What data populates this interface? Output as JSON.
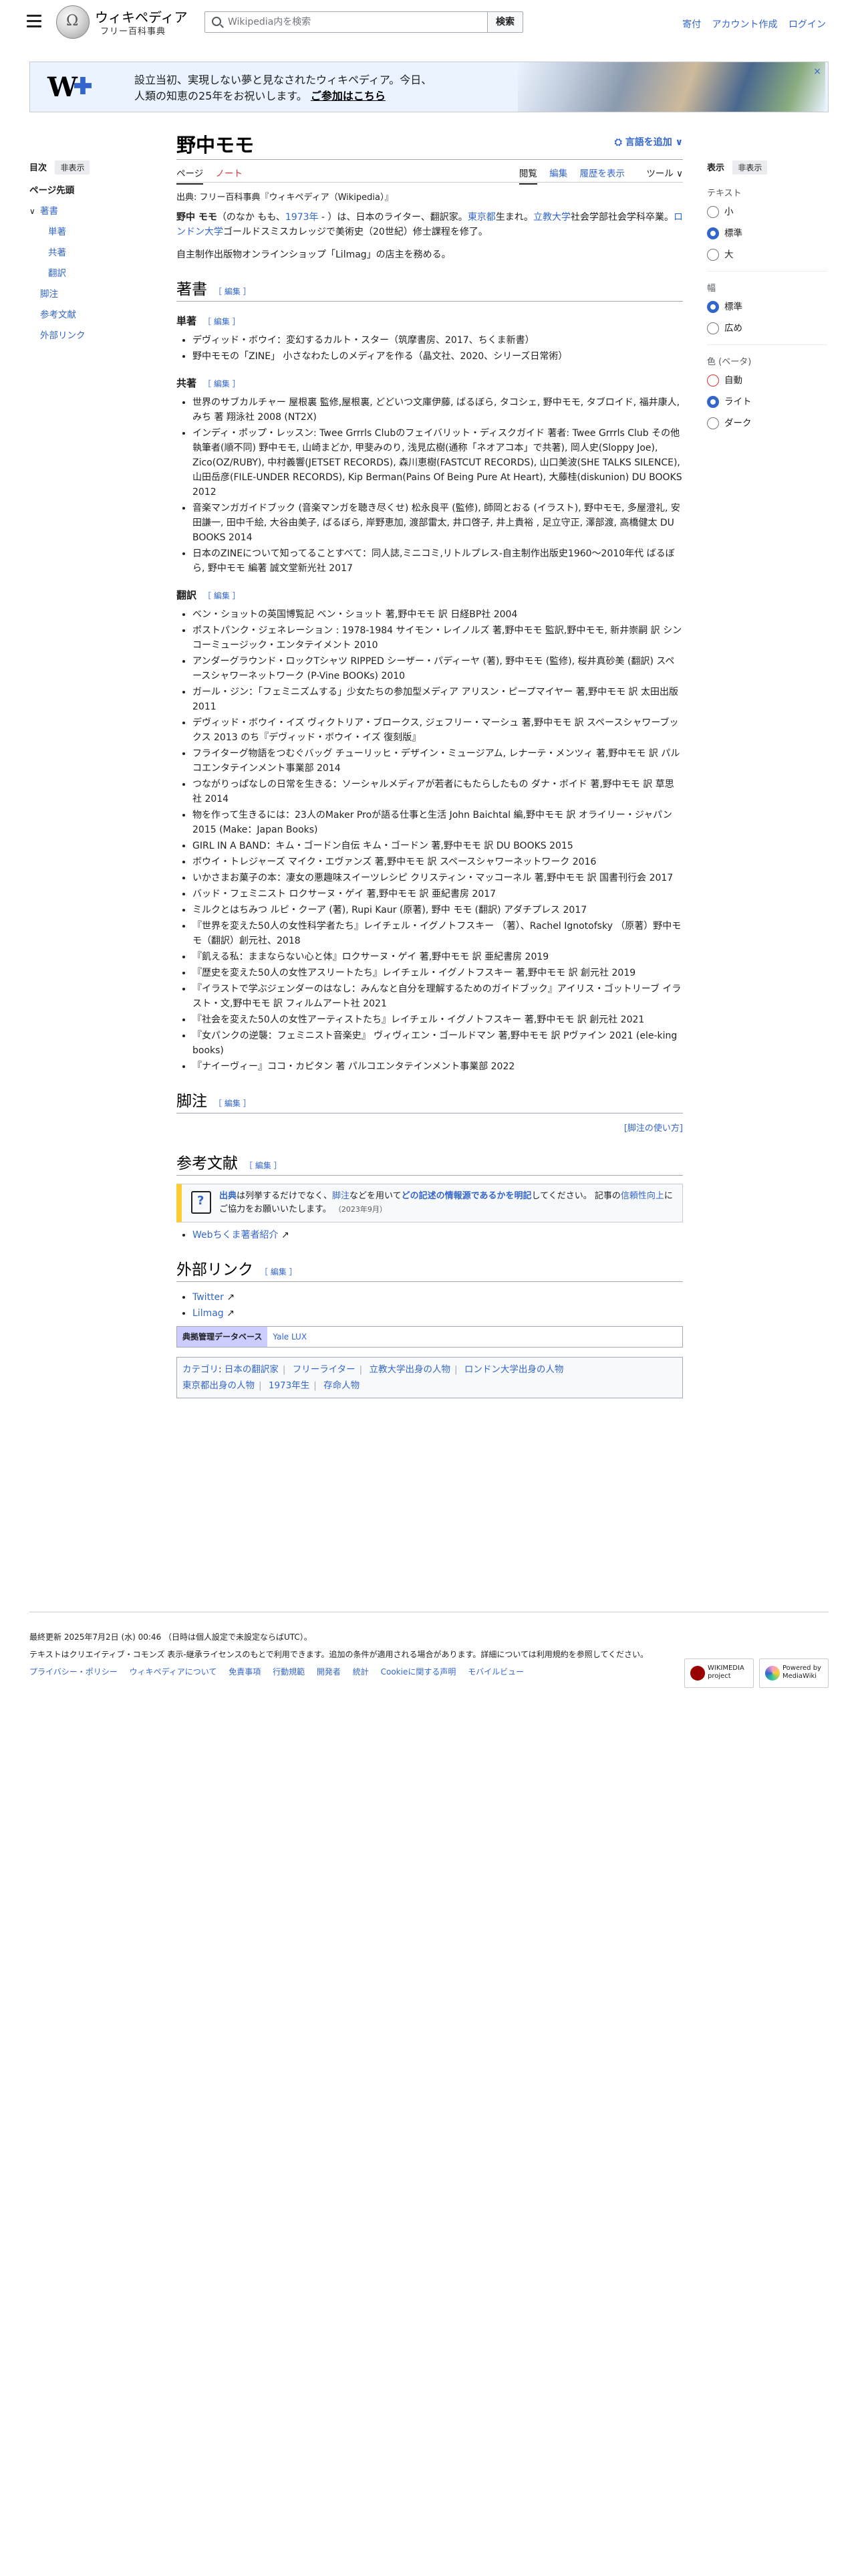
{
  "header": {
    "logo_title": "ウィキペディア",
    "logo_tagline": "フリー百科事典",
    "search_placeholder": "Wikipedia内を検索",
    "search_button": "検索",
    "user_links": [
      "寄付",
      "アカウント作成",
      "ログイン"
    ]
  },
  "banner": {
    "line1": "設立当初、実現しない夢と見なされたウィキペディア。今日、",
    "line2": "人類の知恵の25年をお祝いします。",
    "cta": "ご参加はこちら",
    "close": "×"
  },
  "toc": {
    "title": "目次",
    "hide": "非表示",
    "items": [
      "ページ先頭",
      "著書",
      "単著",
      "共著",
      "翻訳",
      "脚注",
      "参考文献",
      "外部リンク"
    ]
  },
  "page": {
    "title": "野中モモ",
    "lang_button": "言語を追加",
    "tabs_left": [
      "ページ",
      "ノート"
    ],
    "tabs_right": [
      "閲覧",
      "編集",
      "履歴を表示",
      "ツール"
    ],
    "source": "出典: フリー百科事典『ウィキペディア（Wikipedia）』"
  },
  "lead": {
    "p1_bold": "野中 モモ",
    "p1_a": "（のなか もも、",
    "p1_year": "1973年",
    "p1_b": " - ）は、日本のライター、翻訳家。",
    "p1_tokyo": "東京都",
    "p1_c": "生まれ。",
    "p1_rikkyo": "立教大学",
    "p1_d": "社会学部社会学科卒業。",
    "p1_london": "ロンドン大学",
    "p1_e": "ゴールドスミスカレッジで美術史（20世紀）修士課程を修了。",
    "p2": "自主制作出版物オンラインショップ「Lilmag」の店主を務める。"
  },
  "sections": {
    "works": "著書",
    "single": "単著",
    "joint": "共著",
    "translation": "翻訳",
    "notes": "脚注",
    "references": "参考文献",
    "external": "外部リンク",
    "edit": "［ 編集 ］"
  },
  "single_works": [
    "デヴィッド・ボウイ：変幻するカルト・スター（筑摩書房、2017、ちくま新書）",
    "野中モモの「ZINE」 小さなわたしのメディアを作る（晶文社、2020、シリーズ日常術）"
  ],
  "joint_works": [
    "世界のサブカルチャー 屋根裏 監修,屋根裏, どどいつ文庫伊藤, ばるぼら, タコシェ, 野中モモ, タブロイド, 福井康人, みち 著 翔泳社 2008 (NT2X)",
    "インディ・ポップ・レッスン: Twee Grrrls Clubのフェイバリット・ディスクガイド 著者: Twee Grrrls Club その他執筆者(順不同) 野中モモ, 山崎まどか, 甲斐みのり, 浅見広樹(通称「ネオアコ本」で共著), 岡人史(Sloppy Joe), Zico(OZ/RUBY), 中村義響(JETSET RECORDS), 森川恵樹(FASTCUT RECORDS), 山口美波(SHE TALKS SILENCE), 山田岳彦(FILE-UNDER RECORDS), Kip Berman(Pains Of Being Pure At Heart), 大藤桂(diskunion) DU BOOKS 2012",
    "音楽マンガガイドブック (音楽マンガを聴き尽くせ) 松永良平 (監修), 師岡とおる (イラスト), 野中モモ, 多屋澄礼, 安田謙一, 田中千絵, 大谷由美子, ばるぼら, 岸野恵加, 渡部雷太, 井口啓子, 井上貴裕 , 足立守正, 澤部渡, 高橋健太 DU BOOKS 2014",
    "日本のZINEについて知ってることすべて：同人誌,ミニコミ,リトルプレス-自主制作出版史1960〜2010年代 ばるぼら, 野中モモ 編著 誠文堂新光社 2017"
  ],
  "translations": [
    "ベン・ショットの英国博覧記 ベン・ショット 著,野中モモ 訳 日経BP社 2004",
    "ポストパンク・ジェネレーション : 1978-1984 サイモン・レイノルズ 著,野中モモ 監訳,野中モモ, 新井崇嗣 訳 シンコーミュージック・エンタテイメント 2010",
    "アンダーグラウンド・ロックTシャツ RIPPED シーザー・パディーヤ (著), 野中モモ (監修), 桜井真砂美 (翻訳) スペースシャワーネットワーク (P-Vine BOOKs) 2010",
    "ガール・ジン：「フェミニズムする」少女たちの参加型メディア アリスン・ピープマイヤー 著,野中モモ 訳 太田出版 2011",
    "デヴィッド・ボウイ・イズ ヴィクトリア・ブロークス, ジェフリー・マーシュ 著,野中モモ 訳 スペースシャワーブックス 2013 のち『デヴィッド・ボウイ・イズ 復刻版』",
    "フライターグ物語をつむぐバッグ チューリッヒ・デザイン・ミュージアム, レナーテ・メンツィ 著,野中モモ 訳 パルコエンタテインメント事業部 2014",
    "つながりっぱなしの日常を生きる：ソーシャルメディアが若者にもたらしたもの ダナ・ボイド 著,野中モモ 訳 草思社 2014",
    "物を作って生きるには：23人のMaker Proが語る仕事と生活 John Baichtal 編,野中モモ 訳 オライリー・ジャパン 2015 (Make：Japan Books)",
    "GIRL IN A BAND：キム・ゴードン自伝 キム・ゴードン 著,野中モモ 訳 DU BOOKS 2015",
    "ボウイ・トレジャーズ マイク・エヴァンズ 著,野中モモ 訳 スペースシャワーネットワーク 2016",
    "いかさまお菓子の本：凄女の悪趣味スイーツレシピ クリスティン・マッコーネル 著,野中モモ 訳 国書刊行会 2017",
    "バッド・フェミニスト ロクサーヌ・ゲイ 著,野中モモ 訳 亜紀書房 2017",
    "ミルクとはちみつ ルピ・クーア (著), Rupi Kaur (原著), 野中 モモ (翻訳) アダチプレス 2017",
    "『世界を変えた50人の女性科学者たち』レイチェル・イグノトフスキー （著）、Rachel Ignotofsky （原著）野中モモ（翻訳）創元社、2018",
    "『飢える私：ままならない心と体』ロクサーヌ・ゲイ 著,野中モモ 訳 亜紀書房 2019",
    "『歴史を変えた50人の女性アスリートたち』レイチェル・イグノトフスキー 著,野中モモ 訳 創元社 2019",
    "『イラストで学ぶジェンダーのはなし：みんなと自分を理解するためのガイドブック』アイリス・ゴットリーブ イラスト・文,野中モモ 訳 フィルムアート社 2021",
    "『社会を変えた50人の女性アーティストたち』レイチェル・イグノトフスキー 著,野中モモ 訳 創元社 2021",
    "『女パンクの逆襲：フェミニスト音楽史』 ヴィヴィエン・ゴールドマン 著,野中モモ 訳 Pヴァイン 2021 (ele-king books)",
    "『ナイーヴィー』ココ・カピタン 著 パルコエンタテインメント事業部 2022"
  ],
  "notes_link": "[脚注の使い方]",
  "notice": {
    "a": "出典",
    "b": "は列挙するだけでなく、",
    "c": "脚注",
    "d": "などを用いて",
    "e": "どの記述の情報源であるかを明記",
    "f": "してください。 記事の",
    "g": "信頼性向上",
    "h": "にご協力をお願いいたします。",
    "date": "（2023年9月）"
  },
  "references": [
    "Webちくま著者紹介"
  ],
  "external": [
    "Twitter",
    "Lilmag"
  ],
  "authority": {
    "label": "典拠管理データベース",
    "link": "Yale LUX"
  },
  "categories": {
    "label": "カテゴリ",
    "items": [
      "日本の翻訳家",
      "フリーライター",
      "立教大学出身の人物",
      "ロンドン大学出身の人物",
      "東京都出身の人物",
      "1973年生",
      "存命人物"
    ]
  },
  "appearance": {
    "title": "表示",
    "hide": "非表示",
    "text_label": "テキスト",
    "text_opts": [
      "小",
      "標準",
      "大"
    ],
    "width_label": "幅",
    "width_opts": [
      "標準",
      "広め"
    ],
    "color_label": "色 (ベータ)",
    "color_opts": [
      "自動",
      "ライト",
      "ダーク"
    ]
  },
  "footer": {
    "updated": "最終更新 2025年7月2日 (水) 00:46 （日時は個人設定で未設定ならばUTC）。",
    "license": "テキストはクリエイティブ・コモンズ 表示-継承ライセンスのもとで利用できます。追加の条件が適用される場合があります。詳細については利用規約を参照してください。",
    "links": [
      "プライバシー・ポリシー",
      "ウィキペディアについて",
      "免責事項",
      "行動規範",
      "開発者",
      "統計",
      "Cookieに関する声明",
      "モバイルビュー"
    ],
    "badge1": "WIKIMEDIA project",
    "badge2": "Powered by MediaWiki"
  }
}
